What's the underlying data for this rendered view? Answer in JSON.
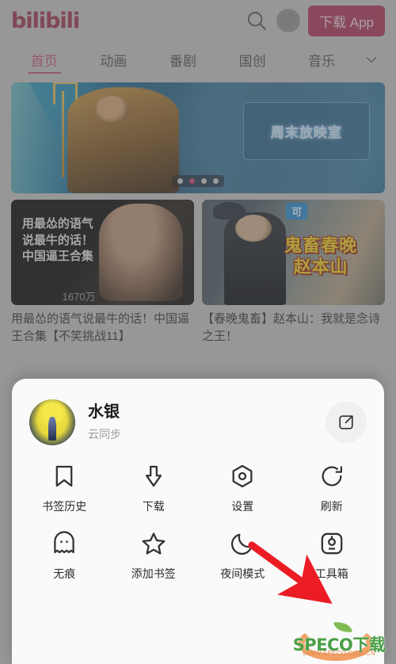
{
  "header": {
    "logo": "bilibili",
    "search_icon": "search-icon",
    "avatar_icon": "user-avatar-icon",
    "download_app_label": "下载 App"
  },
  "nav": {
    "tabs": [
      {
        "label": "首页",
        "active": true
      },
      {
        "label": "动画",
        "active": false
      },
      {
        "label": "番剧",
        "active": false
      },
      {
        "label": "国创",
        "active": false
      },
      {
        "label": "音乐",
        "active": false
      }
    ],
    "expand_icon": "chevron-down-icon"
  },
  "banner": {
    "plaque_text": "周末放映室",
    "dots_total": 4,
    "dots_active_index": 1
  },
  "videos": [
    {
      "overlay_title": "用最怂的语气\n说最牛的话！\n中国逼王合集",
      "overlay_count": "1670万",
      "title": "用最怂的语气说最牛的话！中国逼王合集【不笑挑战11】"
    },
    {
      "badge": "可",
      "overlay_title": "鬼畜春晚\n赵本山",
      "title": "【春晚鬼畜】赵本山：我就是念诗之王！"
    }
  ],
  "sheet": {
    "profile": {
      "avatar_icon": "user-avatar-image",
      "name": "水银",
      "subtitle": "云同步",
      "share_icon": "share-external-icon"
    },
    "actions": [
      {
        "icon": "bookmark-icon",
        "label": "书签历史"
      },
      {
        "icon": "download-icon",
        "label": "下载"
      },
      {
        "icon": "settings-icon",
        "label": "设置"
      },
      {
        "icon": "refresh-icon",
        "label": "刷新"
      },
      {
        "icon": "incognito-ghost-icon",
        "label": "无痕"
      },
      {
        "icon": "star-icon",
        "label": "添加书签"
      },
      {
        "icon": "moon-icon",
        "label": "夜间模式"
      },
      {
        "icon": "toolbox-icon",
        "label": "工具箱"
      }
    ]
  },
  "annotation": {
    "arrow_icon": "red-arrow-icon",
    "arrow_color": "#ec1c24",
    "points_to": "工具箱"
  },
  "watermark": {
    "text": "SPECO下载",
    "url": "WWW.SPECO.COM.CN"
  },
  "colors": {
    "brand_pink": "#b03a5b",
    "tab_active": "#c25a78",
    "sheet_bg": "#fafafa",
    "annotation_red": "#ec1c24"
  }
}
